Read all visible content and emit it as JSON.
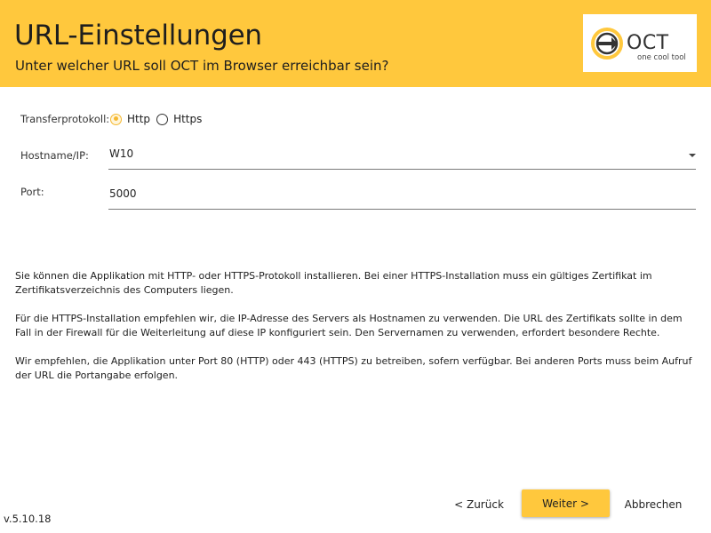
{
  "header": {
    "title": "URL-Einstellungen",
    "subtitle": "Unter welcher URL soll OCT im Browser erreichbar sein?",
    "logo_name": "OCT",
    "logo_tagline": "one cool tool"
  },
  "form": {
    "protocol_label": "Transferprotokoll:",
    "protocol_options": [
      "Http",
      "Https"
    ],
    "protocol_selected": "Http",
    "host_label": "Hostname/IP:",
    "host_value": "W10",
    "port_label": "Port:",
    "port_value": "5000"
  },
  "info": {
    "p1": "Sie können die Applikation mit HTTP- oder HTTPS-Protokoll installieren. Bei einer HTTPS-Installation muss ein gültiges Zertifikat im Zertifikatsverzeichnis des Computers liegen.",
    "p2": "Für die HTTPS-Installation empfehlen wir, die IP-Adresse des Servers als Hostnamen zu verwenden. Die URL des Zertifikats sollte in dem Fall in der Firewall für die Weiterleitung auf diese IP konfiguriert sein. Den Servernamen zu verwenden, erfordert besondere Rechte.",
    "p3": "Wir empfehlen, die Applikation unter Port 80 (HTTP) oder 443 (HTTPS) zu betreiben, sofern verfügbar. Bei anderen Ports muss beim Aufruf der URL die Portangabe erfolgen."
  },
  "footer": {
    "back_label": "< Zurück",
    "next_label": "Weiter >",
    "cancel_label": "Abbrechen",
    "version": "v.5.10.18"
  },
  "colors": {
    "accent": "#FFC83D",
    "radio_accent": "#F5B830"
  }
}
